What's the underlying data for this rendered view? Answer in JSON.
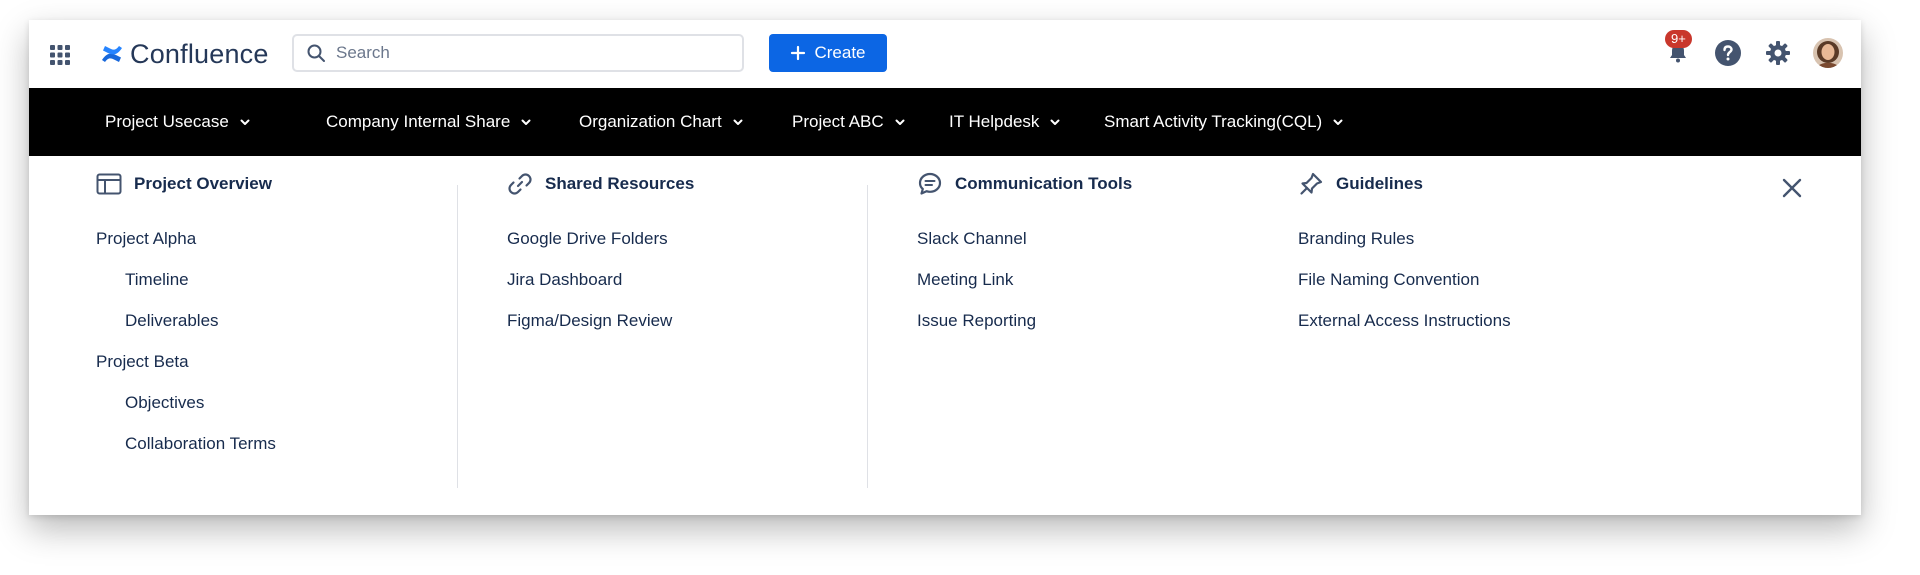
{
  "app": {
    "name": "Confluence"
  },
  "search": {
    "placeholder": "Search"
  },
  "create": {
    "label": "Create"
  },
  "notifications": {
    "badge": "9+"
  },
  "colors": {
    "nav_bg": "#000000",
    "accent": "#0c66e4",
    "badge": "#c9372c",
    "logo_blue": "#2684ff"
  },
  "nav": {
    "items": [
      {
        "label": "Project Usecase"
      },
      {
        "label": "Company Internal Share"
      },
      {
        "label": "Organization Chart"
      },
      {
        "label": "Project ABC"
      },
      {
        "label": "IT Helpdesk"
      },
      {
        "label": "Smart Activity Tracking(CQL)"
      }
    ]
  },
  "menu": {
    "columns": [
      {
        "title": "Project Overview",
        "icon": "layout-icon",
        "links": [
          {
            "label": "Project Alpha"
          },
          {
            "label": "Timeline"
          },
          {
            "label": "Deliverables"
          },
          {
            "label": "Project Beta"
          },
          {
            "label": "Objectives"
          },
          {
            "label": "Collaboration Terms"
          }
        ]
      },
      {
        "title": "Shared Resources",
        "icon": "link-icon",
        "links": [
          {
            "label": "Google Drive Folders"
          },
          {
            "label": "Jira Dashboard"
          },
          {
            "label": "Figma/Design Review"
          }
        ]
      },
      {
        "title": "Communication Tools",
        "icon": "chat-icon",
        "links": [
          {
            "label": "Slack Channel"
          },
          {
            "label": "Meeting Link"
          },
          {
            "label": "Issue Reporting"
          }
        ]
      },
      {
        "title": "Guidelines",
        "icon": "pin-icon",
        "links": [
          {
            "label": "Branding Rules"
          },
          {
            "label": "File Naming Convention"
          },
          {
            "label": "External Access Instructions"
          }
        ]
      }
    ]
  }
}
